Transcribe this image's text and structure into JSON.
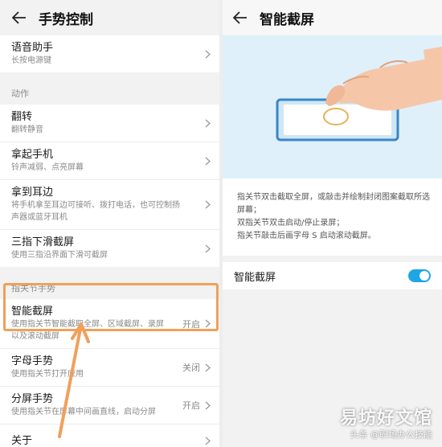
{
  "left": {
    "title": "手势控制",
    "top_item": {
      "title": "语音助手",
      "subtitle": "长按电源键"
    },
    "section_actions": "动作",
    "actions": [
      {
        "title": "翻转",
        "subtitle": "翻转静音"
      },
      {
        "title": "拿起手机",
        "subtitle": "铃声减弱、点亮屏幕"
      },
      {
        "title": "拿到耳边",
        "subtitle": "将手机拿至耳边可接听、拨打电话，也可控制扬声器或蓝牙耳机"
      },
      {
        "title": "三指下滑截屏",
        "subtitle": "使用三指沿界面下滑可截屏"
      }
    ],
    "section_knuckle": "指关节手势",
    "knuckle": [
      {
        "title": "智能截屏",
        "subtitle": "使用指关节智能截取全屏、区域截屏、录屏以及滚动截屏",
        "status": "开启"
      },
      {
        "title": "字母手势",
        "subtitle": "使用指关节打开应用",
        "status": "关闭"
      },
      {
        "title": "分屏手势",
        "subtitle": "使用指关节在屏幕中间画直线，启动分屏",
        "status": "开启"
      }
    ],
    "about": {
      "title": "关于"
    }
  },
  "right": {
    "title": "智能截屏",
    "description": [
      "指关节双击截取全屏，或敲击并绘制封闭图案截取所选屏幕；",
      "双指关节双击启动/停止录屏；",
      "指关节敲击后画字母 S 启动滚动截屏。"
    ],
    "toggle_label": "智能截屏",
    "toggle_on": true
  },
  "watermark": {
    "brand": "易坊好文馆",
    "sub": "头条 @职场办公技能"
  },
  "colors": {
    "accent": "#1ea6e6",
    "highlight": "#f0a05a"
  }
}
